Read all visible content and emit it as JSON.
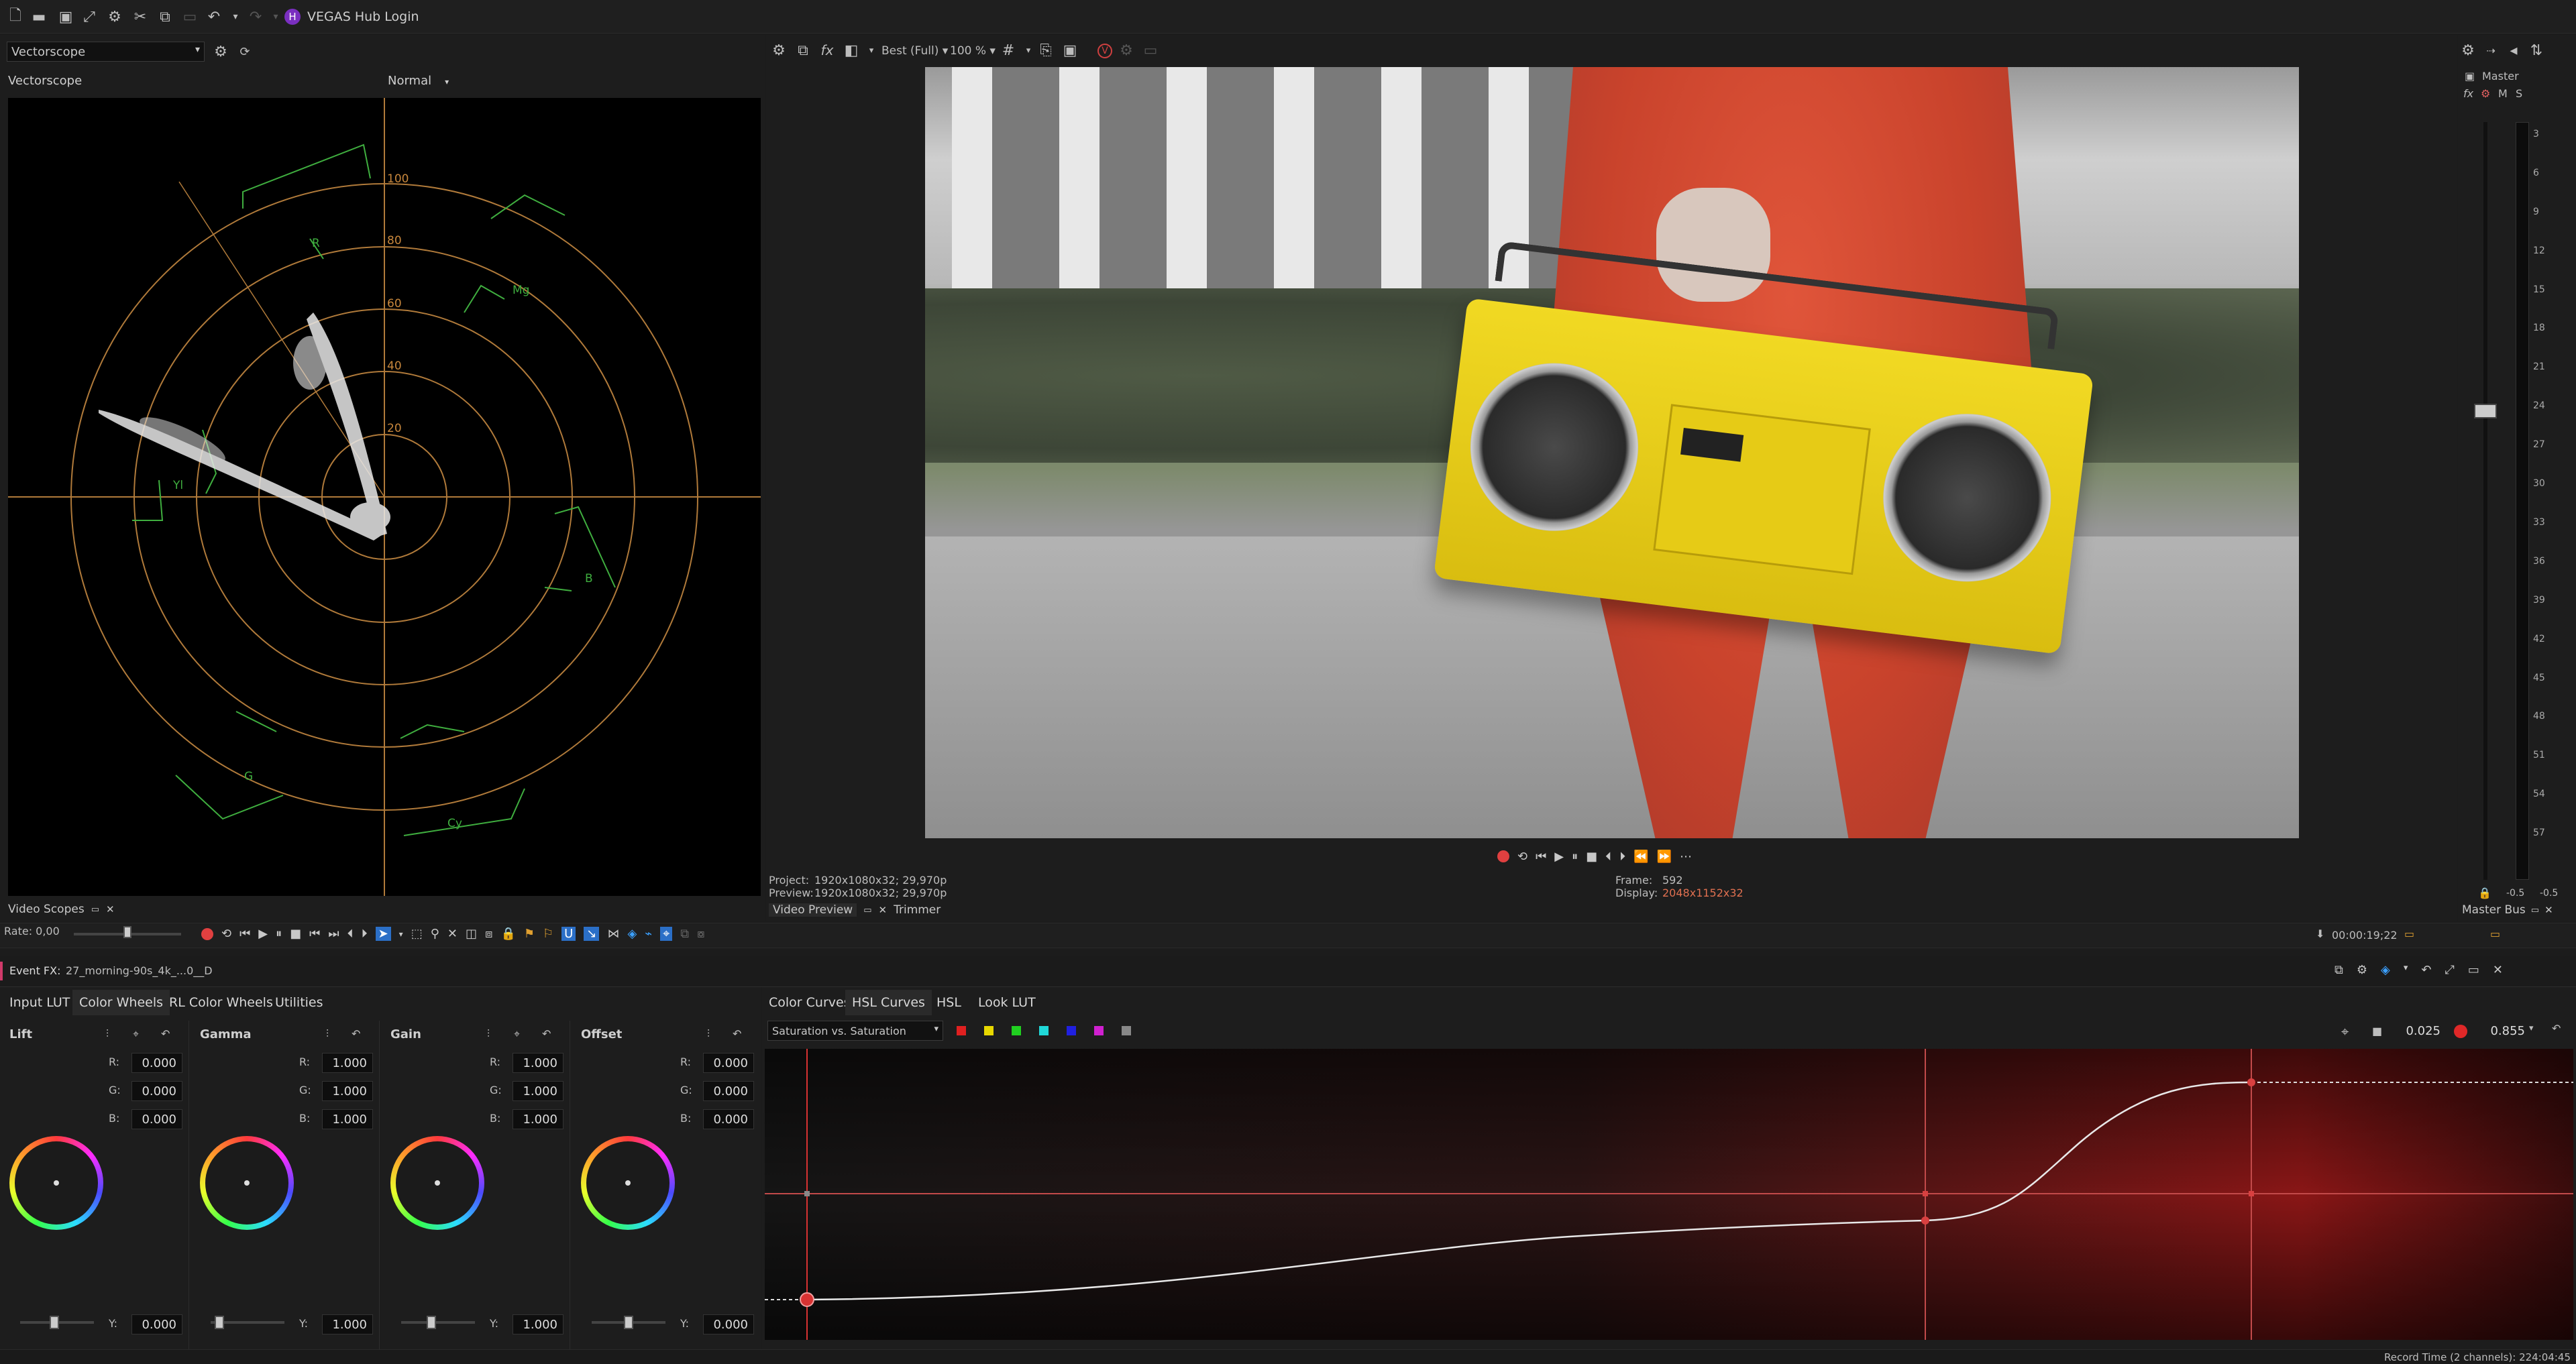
{
  "titlebar": {
    "hub_login": "VEGAS Hub Login"
  },
  "scopes": {
    "scope_select": "Vectorscope",
    "scope_title": "Vectorscope",
    "mode": "Normal",
    "ring_labels": [
      "100",
      "80",
      "60",
      "40",
      "20"
    ],
    "target_labels": [
      "R",
      "Mg",
      "B",
      "Cy",
      "G",
      "Yl"
    ],
    "dock_tab": "Video Scopes"
  },
  "preview": {
    "quality": "Best (Full)",
    "zoom": "100 %",
    "project_label": "Project:",
    "project_value": "1920x1080x32; 29,970p",
    "preview_label": "Preview:",
    "preview_value": "1920x1080x32; 29,970p",
    "frame_label": "Frame:",
    "frame_value": "592",
    "display_label": "Display:",
    "display_value": "2048x1152x32",
    "dock_tab_1": "Video Preview",
    "dock_tab_2": "Trimmer"
  },
  "mixer": {
    "master_label": "Master",
    "m": "M",
    "s": "S",
    "scale": [
      "3",
      "6",
      "9",
      "12",
      "15",
      "18",
      "21",
      "24",
      "27",
      "30",
      "33",
      "36",
      "39",
      "42",
      "45",
      "48",
      "51",
      "54",
      "57"
    ],
    "bottom_left": "-0.5",
    "bottom_right": "-0.5",
    "dock_tab": "Master Bus"
  },
  "transport": {
    "rate": "Rate: 0,00",
    "timecode": "00:00:19;22"
  },
  "event_fx": {
    "label": "Event FX:",
    "clip_name": "27_morning-90s_4k_...0__D"
  },
  "color_tabs": [
    "Input LUT",
    "Color Wheels",
    "RL Color Wheels",
    "Utilities"
  ],
  "wheels": [
    {
      "title": "Lift",
      "r": "0.000",
      "g": "0.000",
      "b": "0.000",
      "y": "0.000"
    },
    {
      "title": "Gamma",
      "r": "1.000",
      "g": "1.000",
      "b": "1.000",
      "y": "1.000"
    },
    {
      "title": "Gain",
      "r": "1.000",
      "g": "1.000",
      "b": "1.000",
      "y": "1.000"
    },
    {
      "title": "Offset",
      "r": "0.000",
      "g": "0.000",
      "b": "0.000",
      "y": "0.000"
    }
  ],
  "channel_labels": {
    "r": "R:",
    "g": "G:",
    "b": "B:",
    "y": "Y:"
  },
  "curves": {
    "tabs": [
      "Color Curves",
      "HSL Curves",
      "HSL",
      "Look LUT"
    ],
    "mode_select": "Saturation vs. Saturation",
    "swatches": [
      "#e02020",
      "#e8d800",
      "#20d020",
      "#20d8d8",
      "#2020e0",
      "#d020d0",
      "#888888"
    ],
    "value_1": "0.025",
    "value_2": "0.855"
  },
  "status": {
    "record_time": "Record Time (2 channels): 224:04:45"
  }
}
